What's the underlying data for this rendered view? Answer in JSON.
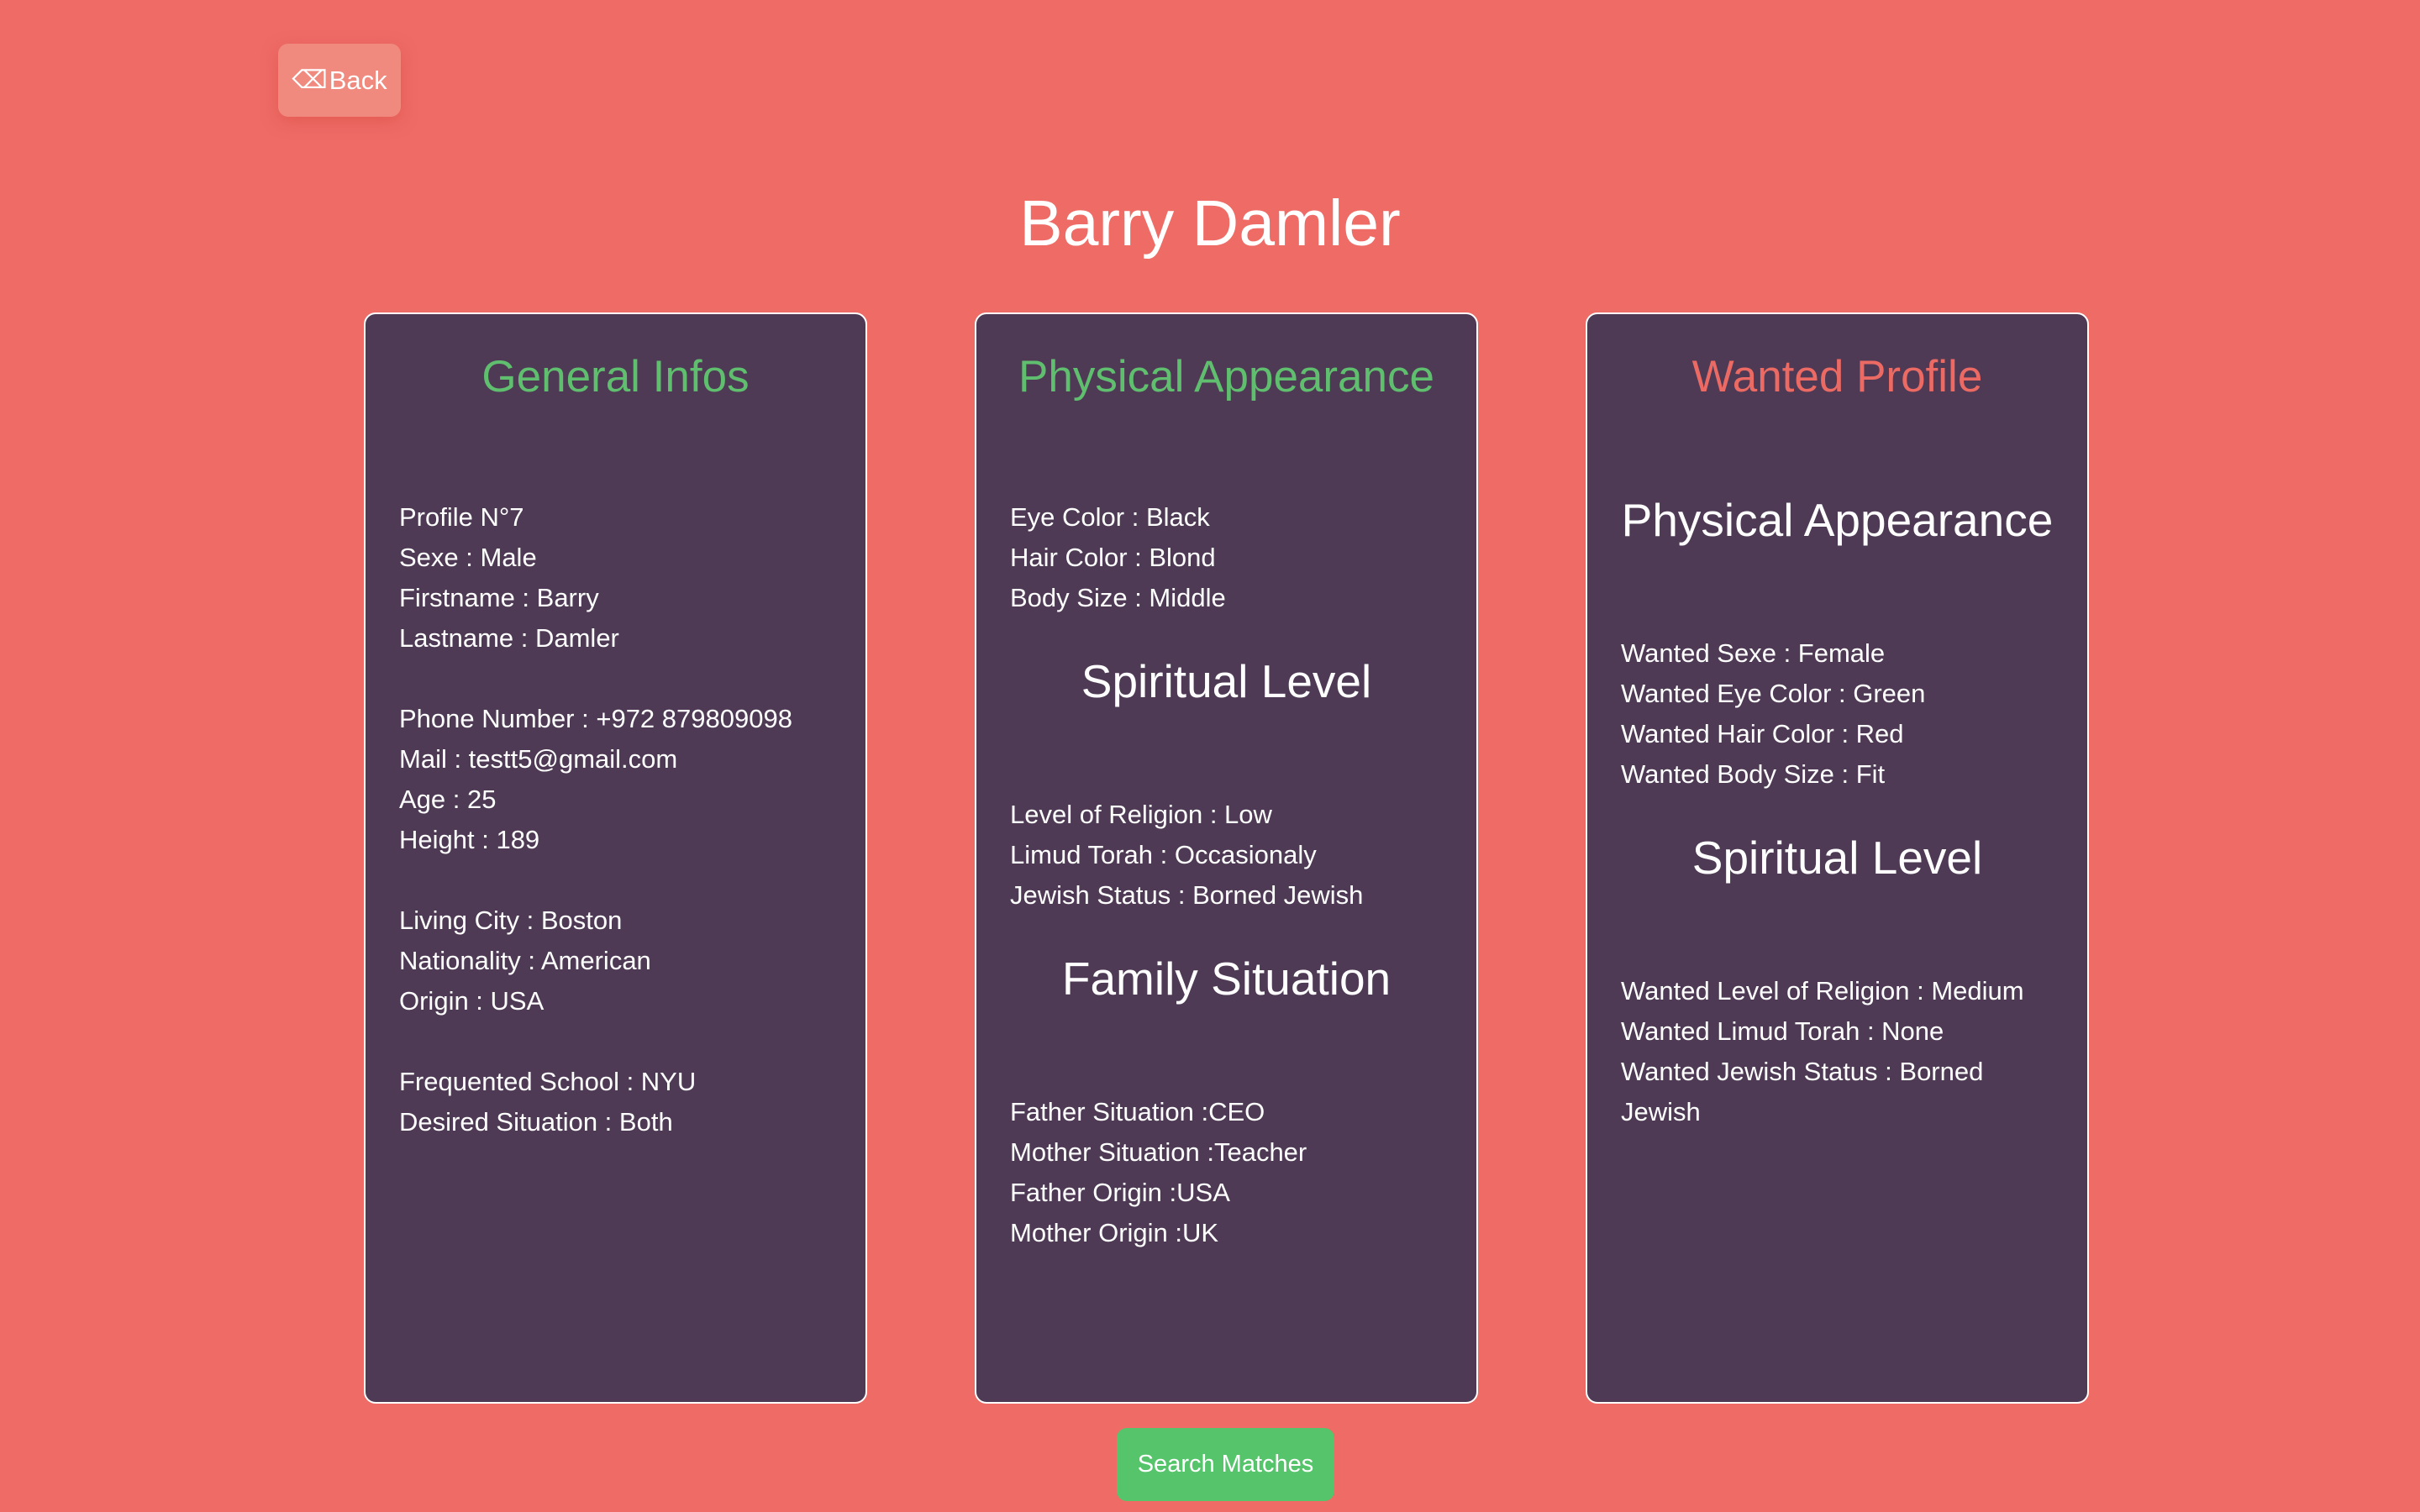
{
  "back_button": {
    "icon": "⌫",
    "label": "Back"
  },
  "page_title": "Barry Damler",
  "general": {
    "title": "General Infos",
    "group1": [
      "Profile N°7",
      "Sexe : Male",
      "Firstname : Barry",
      "Lastname : Damler"
    ],
    "group2": [
      "Phone Number : +972 879809098",
      "Mail : testt5@gmail.com",
      "Age : 25",
      "Height : 189"
    ],
    "group3": [
      "Living City : Boston",
      "Nationality : American",
      "Origin : USA"
    ],
    "group4": [
      "Frequented School : NYU",
      "Desired Situation : Both"
    ]
  },
  "physical": {
    "title": "Physical Appearance",
    "appearance": [
      "Eye Color : Black",
      "Hair Color : Blond",
      "Body Size : Middle"
    ],
    "spiritual_heading": "Spiritual Level",
    "spiritual": [
      "Level of Religion : Low",
      "Limud Torah : Occasionaly",
      "Jewish Status : Borned Jewish"
    ],
    "family_heading": "Family Situation",
    "family": [
      "Father Situation :CEO",
      "Mother Situation :Teacher",
      "Father Origin :USA",
      "Mother Origin :UK"
    ]
  },
  "wanted": {
    "title": "Wanted Profile",
    "physical_heading": "Physical Appearance",
    "physical": [
      "Wanted Sexe : Female",
      "Wanted Eye Color : Green",
      "Wanted Hair Color : Red",
      "Wanted Body Size : Fit"
    ],
    "spiritual_heading": "Spiritual Level",
    "spiritual": [
      "Wanted Level of Religion : Medium",
      "Wanted Limud Torah : None",
      "Wanted Jewish Status : Borned Jewish"
    ]
  },
  "search_button": {
    "label": "Search Matches"
  },
  "colors": {
    "background": "#ee6b66",
    "card": "#4f3a55",
    "green_accent": "#5fbf6f",
    "red_accent": "#ec6a64",
    "button_green": "#56c46b"
  }
}
